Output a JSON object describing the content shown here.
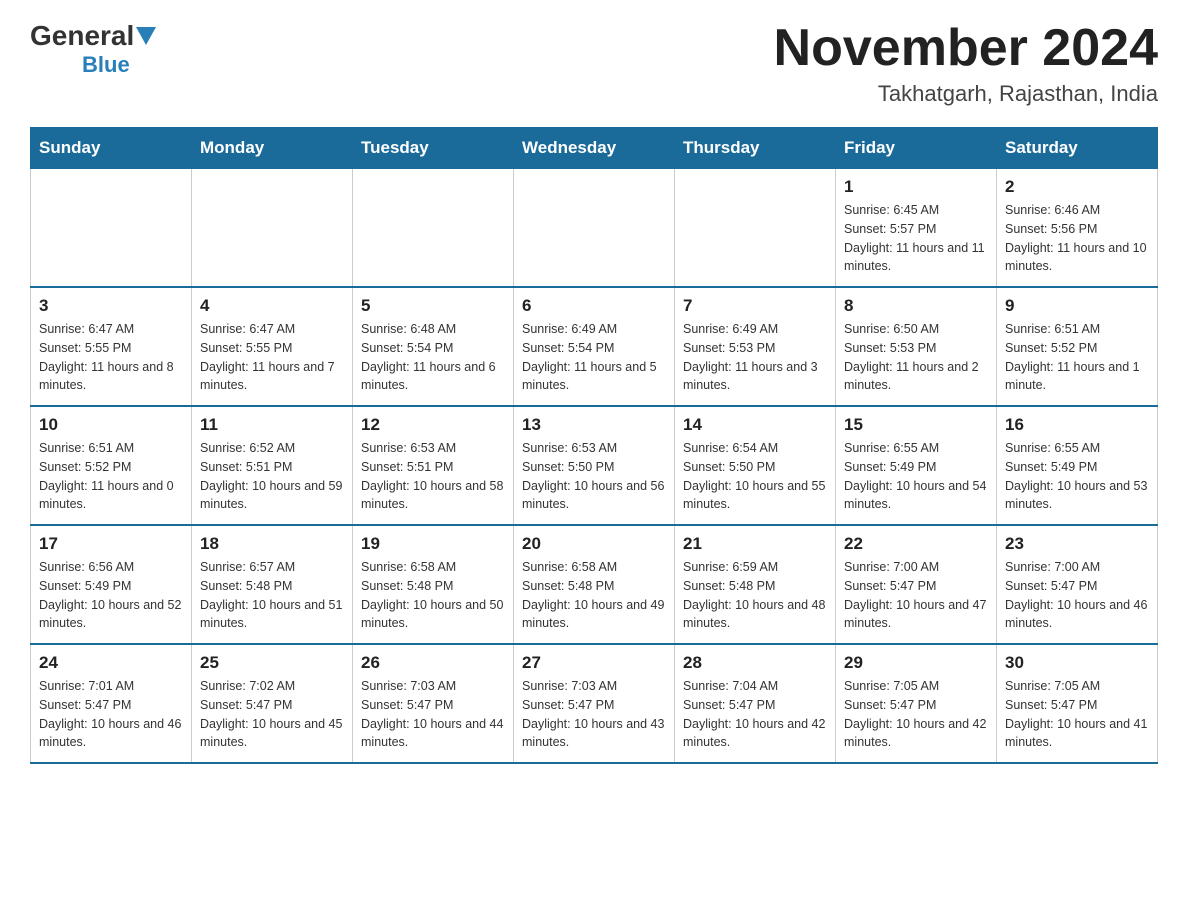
{
  "header": {
    "logo_general": "General",
    "logo_blue": "Blue",
    "title": "November 2024",
    "location": "Takhatgarh, Rajasthan, India"
  },
  "days_of_week": [
    "Sunday",
    "Monday",
    "Tuesday",
    "Wednesday",
    "Thursday",
    "Friday",
    "Saturday"
  ],
  "weeks": [
    [
      {
        "date": "",
        "sunrise": "",
        "sunset": "",
        "daylight": ""
      },
      {
        "date": "",
        "sunrise": "",
        "sunset": "",
        "daylight": ""
      },
      {
        "date": "",
        "sunrise": "",
        "sunset": "",
        "daylight": ""
      },
      {
        "date": "",
        "sunrise": "",
        "sunset": "",
        "daylight": ""
      },
      {
        "date": "",
        "sunrise": "",
        "sunset": "",
        "daylight": ""
      },
      {
        "date": "1",
        "sunrise": "Sunrise: 6:45 AM",
        "sunset": "Sunset: 5:57 PM",
        "daylight": "Daylight: 11 hours and 11 minutes."
      },
      {
        "date": "2",
        "sunrise": "Sunrise: 6:46 AM",
        "sunset": "Sunset: 5:56 PM",
        "daylight": "Daylight: 11 hours and 10 minutes."
      }
    ],
    [
      {
        "date": "3",
        "sunrise": "Sunrise: 6:47 AM",
        "sunset": "Sunset: 5:55 PM",
        "daylight": "Daylight: 11 hours and 8 minutes."
      },
      {
        "date": "4",
        "sunrise": "Sunrise: 6:47 AM",
        "sunset": "Sunset: 5:55 PM",
        "daylight": "Daylight: 11 hours and 7 minutes."
      },
      {
        "date": "5",
        "sunrise": "Sunrise: 6:48 AM",
        "sunset": "Sunset: 5:54 PM",
        "daylight": "Daylight: 11 hours and 6 minutes."
      },
      {
        "date": "6",
        "sunrise": "Sunrise: 6:49 AM",
        "sunset": "Sunset: 5:54 PM",
        "daylight": "Daylight: 11 hours and 5 minutes."
      },
      {
        "date": "7",
        "sunrise": "Sunrise: 6:49 AM",
        "sunset": "Sunset: 5:53 PM",
        "daylight": "Daylight: 11 hours and 3 minutes."
      },
      {
        "date": "8",
        "sunrise": "Sunrise: 6:50 AM",
        "sunset": "Sunset: 5:53 PM",
        "daylight": "Daylight: 11 hours and 2 minutes."
      },
      {
        "date": "9",
        "sunrise": "Sunrise: 6:51 AM",
        "sunset": "Sunset: 5:52 PM",
        "daylight": "Daylight: 11 hours and 1 minute."
      }
    ],
    [
      {
        "date": "10",
        "sunrise": "Sunrise: 6:51 AM",
        "sunset": "Sunset: 5:52 PM",
        "daylight": "Daylight: 11 hours and 0 minutes."
      },
      {
        "date": "11",
        "sunrise": "Sunrise: 6:52 AM",
        "sunset": "Sunset: 5:51 PM",
        "daylight": "Daylight: 10 hours and 59 minutes."
      },
      {
        "date": "12",
        "sunrise": "Sunrise: 6:53 AM",
        "sunset": "Sunset: 5:51 PM",
        "daylight": "Daylight: 10 hours and 58 minutes."
      },
      {
        "date": "13",
        "sunrise": "Sunrise: 6:53 AM",
        "sunset": "Sunset: 5:50 PM",
        "daylight": "Daylight: 10 hours and 56 minutes."
      },
      {
        "date": "14",
        "sunrise": "Sunrise: 6:54 AM",
        "sunset": "Sunset: 5:50 PM",
        "daylight": "Daylight: 10 hours and 55 minutes."
      },
      {
        "date": "15",
        "sunrise": "Sunrise: 6:55 AM",
        "sunset": "Sunset: 5:49 PM",
        "daylight": "Daylight: 10 hours and 54 minutes."
      },
      {
        "date": "16",
        "sunrise": "Sunrise: 6:55 AM",
        "sunset": "Sunset: 5:49 PM",
        "daylight": "Daylight: 10 hours and 53 minutes."
      }
    ],
    [
      {
        "date": "17",
        "sunrise": "Sunrise: 6:56 AM",
        "sunset": "Sunset: 5:49 PM",
        "daylight": "Daylight: 10 hours and 52 minutes."
      },
      {
        "date": "18",
        "sunrise": "Sunrise: 6:57 AM",
        "sunset": "Sunset: 5:48 PM",
        "daylight": "Daylight: 10 hours and 51 minutes."
      },
      {
        "date": "19",
        "sunrise": "Sunrise: 6:58 AM",
        "sunset": "Sunset: 5:48 PM",
        "daylight": "Daylight: 10 hours and 50 minutes."
      },
      {
        "date": "20",
        "sunrise": "Sunrise: 6:58 AM",
        "sunset": "Sunset: 5:48 PM",
        "daylight": "Daylight: 10 hours and 49 minutes."
      },
      {
        "date": "21",
        "sunrise": "Sunrise: 6:59 AM",
        "sunset": "Sunset: 5:48 PM",
        "daylight": "Daylight: 10 hours and 48 minutes."
      },
      {
        "date": "22",
        "sunrise": "Sunrise: 7:00 AM",
        "sunset": "Sunset: 5:47 PM",
        "daylight": "Daylight: 10 hours and 47 minutes."
      },
      {
        "date": "23",
        "sunrise": "Sunrise: 7:00 AM",
        "sunset": "Sunset: 5:47 PM",
        "daylight": "Daylight: 10 hours and 46 minutes."
      }
    ],
    [
      {
        "date": "24",
        "sunrise": "Sunrise: 7:01 AM",
        "sunset": "Sunset: 5:47 PM",
        "daylight": "Daylight: 10 hours and 46 minutes."
      },
      {
        "date": "25",
        "sunrise": "Sunrise: 7:02 AM",
        "sunset": "Sunset: 5:47 PM",
        "daylight": "Daylight: 10 hours and 45 minutes."
      },
      {
        "date": "26",
        "sunrise": "Sunrise: 7:03 AM",
        "sunset": "Sunset: 5:47 PM",
        "daylight": "Daylight: 10 hours and 44 minutes."
      },
      {
        "date": "27",
        "sunrise": "Sunrise: 7:03 AM",
        "sunset": "Sunset: 5:47 PM",
        "daylight": "Daylight: 10 hours and 43 minutes."
      },
      {
        "date": "28",
        "sunrise": "Sunrise: 7:04 AM",
        "sunset": "Sunset: 5:47 PM",
        "daylight": "Daylight: 10 hours and 42 minutes."
      },
      {
        "date": "29",
        "sunrise": "Sunrise: 7:05 AM",
        "sunset": "Sunset: 5:47 PM",
        "daylight": "Daylight: 10 hours and 42 minutes."
      },
      {
        "date": "30",
        "sunrise": "Sunrise: 7:05 AM",
        "sunset": "Sunset: 5:47 PM",
        "daylight": "Daylight: 10 hours and 41 minutes."
      }
    ]
  ]
}
